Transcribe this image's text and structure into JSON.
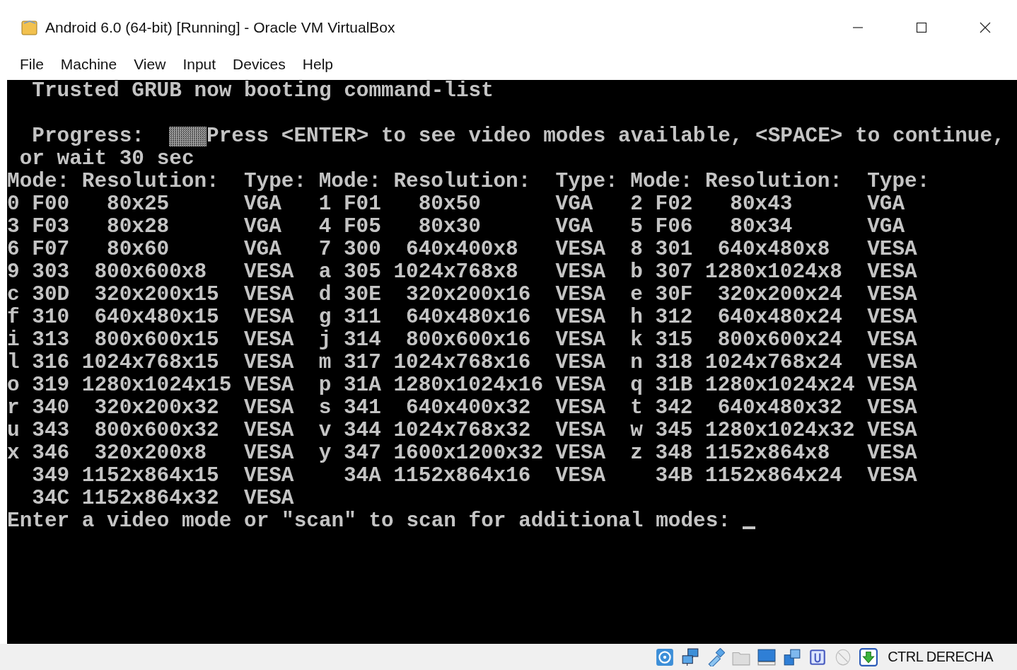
{
  "window": {
    "title": "Android 6.0 (64-bit) [Running] - Oracle VM VirtualBox"
  },
  "menu": [
    "File",
    "Machine",
    "View",
    "Input",
    "Devices",
    "Help"
  ],
  "console": {
    "banner": "Trusted GRUB now booting command-list",
    "progress_label": "Progress:",
    "progress_message": "Press <ENTER> to see video modes available, <SPACE> to continue,",
    "wait_message": "or wait 30 sec",
    "columns": [
      "Mode:",
      "Resolution:",
      "Type:",
      "Mode:",
      "Resolution:",
      "Type:",
      "Mode:",
      "Resolution:",
      "Type:"
    ],
    "rows": [
      [
        "0 F00",
        "80x25",
        "VGA",
        "1 F01",
        "80x50",
        "VGA",
        "2 F02",
        "80x43",
        "VGA"
      ],
      [
        "3 F03",
        "80x28",
        "VGA",
        "4 F05",
        "80x30",
        "VGA",
        "5 F06",
        "80x34",
        "VGA"
      ],
      [
        "6 F07",
        "80x60",
        "VGA",
        "7 300",
        "640x400x8",
        "VESA",
        "8 301",
        "640x480x8",
        "VESA"
      ],
      [
        "9 303",
        "800x600x8",
        "VESA",
        "a 305",
        "1024x768x8",
        "VESA",
        "b 307",
        "1280x1024x8",
        "VESA"
      ],
      [
        "c 30D",
        "320x200x15",
        "VESA",
        "d 30E",
        "320x200x16",
        "VESA",
        "e 30F",
        "320x200x24",
        "VESA"
      ],
      [
        "f 310",
        "640x480x15",
        "VESA",
        "g 311",
        "640x480x16",
        "VESA",
        "h 312",
        "640x480x24",
        "VESA"
      ],
      [
        "i 313",
        "800x600x15",
        "VESA",
        "j 314",
        "800x600x16",
        "VESA",
        "k 315",
        "800x600x24",
        "VESA"
      ],
      [
        "l 316",
        "1024x768x15",
        "VESA",
        "m 317",
        "1024x768x16",
        "VESA",
        "n 318",
        "1024x768x24",
        "VESA"
      ],
      [
        "o 319",
        "1280x1024x15",
        "VESA",
        "p 31A",
        "1280x1024x16",
        "VESA",
        "q 31B",
        "1280x1024x24",
        "VESA"
      ],
      [
        "r 340",
        "320x200x32",
        "VESA",
        "s 341",
        "640x400x32",
        "VESA",
        "t 342",
        "640x480x32",
        "VESA"
      ],
      [
        "u 343",
        "800x600x32",
        "VESA",
        "v 344",
        "1024x768x32",
        "VESA",
        "w 345",
        "1280x1024x32",
        "VESA"
      ],
      [
        "x 346",
        "320x200x8",
        "VESA",
        "y 347",
        "1600x1200x32",
        "VESA",
        "z 348",
        "1152x864x8",
        "VESA"
      ],
      [
        "349",
        "1152x864x15",
        "VESA",
        "34A",
        "1152x864x16",
        "VESA",
        "34B",
        "1152x864x24",
        "VESA"
      ],
      [
        "34C",
        "1152x864x32",
        "VESA"
      ]
    ],
    "prompt": "Enter a video mode or \"scan\" to scan for additional modes:"
  },
  "status_bar": {
    "host_key": "CTRL DERECHA"
  }
}
